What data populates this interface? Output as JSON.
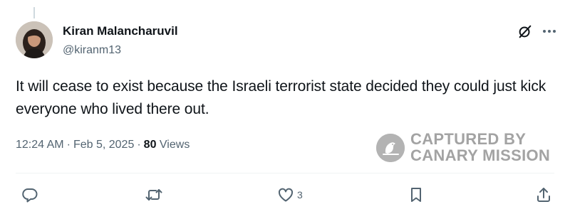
{
  "author": {
    "display_name": "Kiran Malancharuvil",
    "handle": "@kiranm13"
  },
  "tweet": {
    "text": "It will cease to exist because the Israeli terrorist state decided they could just kick everyone who lived there out."
  },
  "meta": {
    "time": "12:24 AM",
    "separator": "·",
    "date": "Feb 5, 2025",
    "views_count": "80",
    "views_label": "Views"
  },
  "watermark": {
    "line1": "CAPTURED BY",
    "line2": "CANARY MISSION"
  },
  "actions": {
    "reply_icon": "reply-icon",
    "retweet_icon": "retweet-icon",
    "like_icon": "heart-icon",
    "like_count": "3",
    "bookmark_icon": "bookmark-icon",
    "share_icon": "share-icon"
  },
  "colors": {
    "text_primary": "#0f1419",
    "text_secondary": "#536471",
    "divider": "#eff3f4",
    "watermark": "#a3a3a3"
  }
}
